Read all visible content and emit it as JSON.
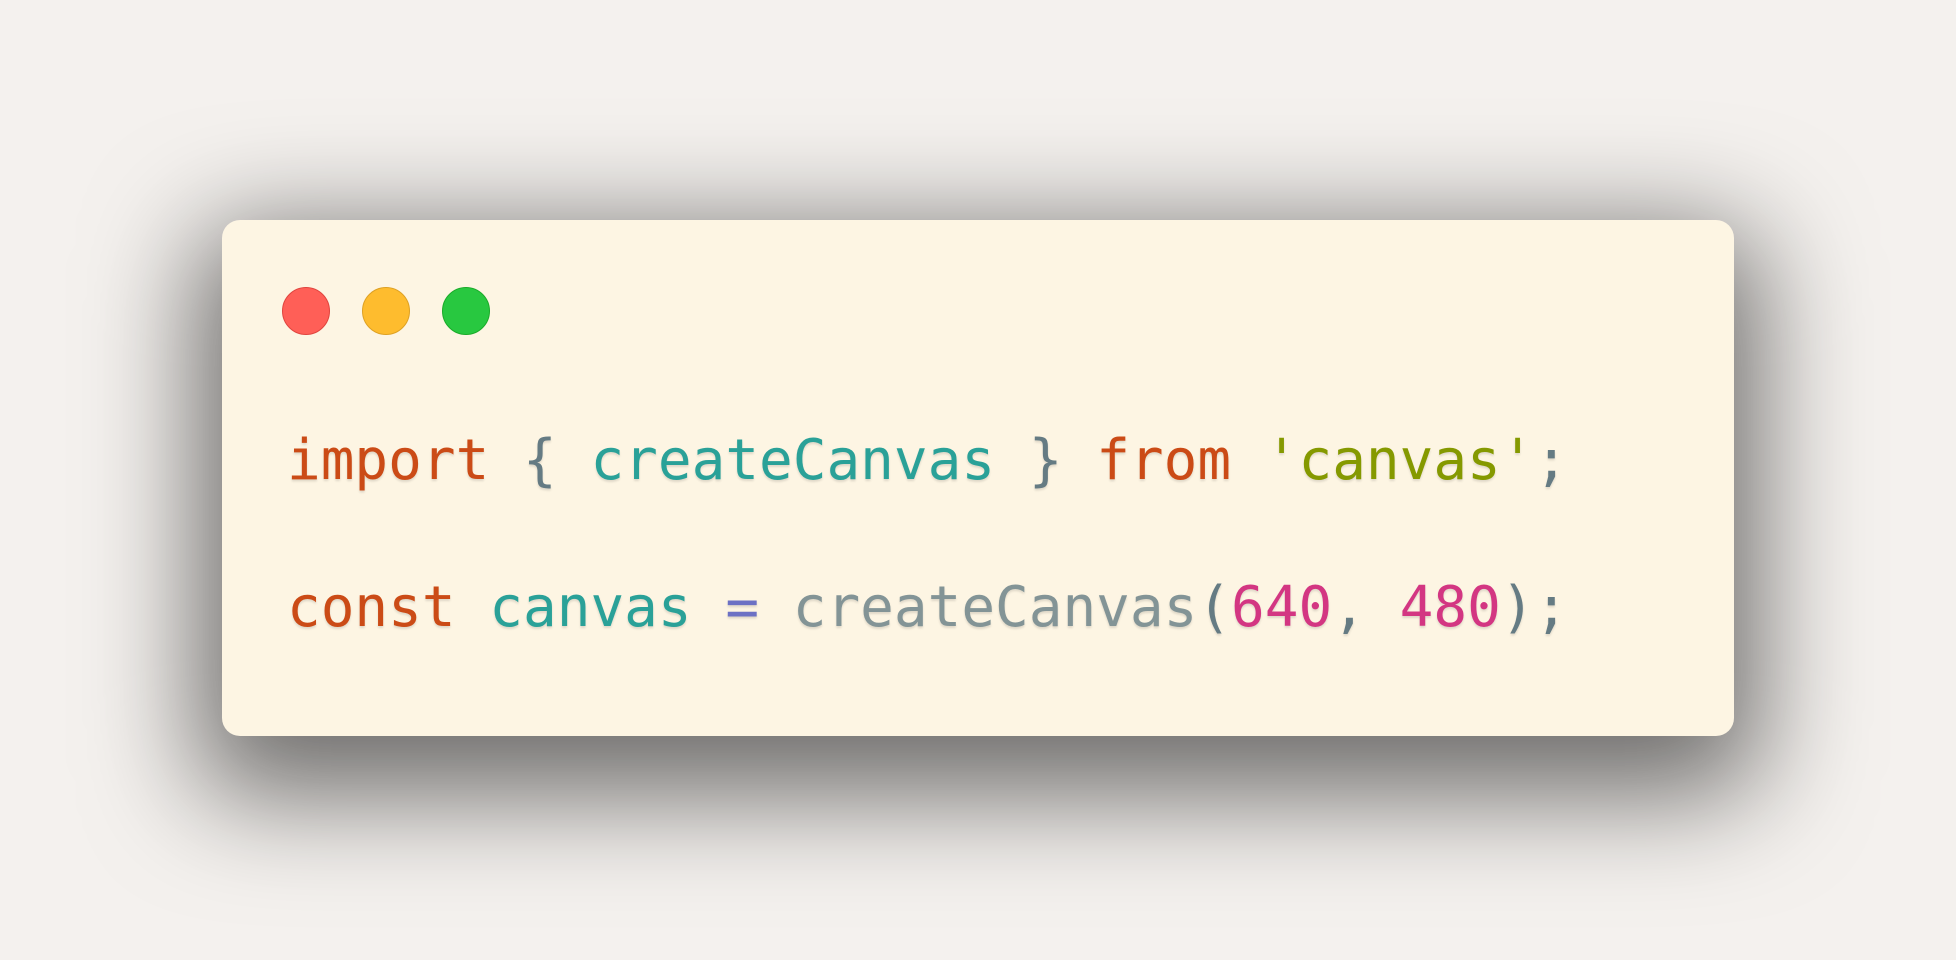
{
  "window_controls": {
    "close_color": "#ff5f57",
    "minimize_color": "#febc2e",
    "maximize_color": "#28c840"
  },
  "code": {
    "line1": {
      "kw_import": "import",
      "brace_open": " { ",
      "identifier": "createCanvas",
      "brace_close": " } ",
      "kw_from": "from",
      "space": " ",
      "module_string": "'canvas'",
      "semicolon": ";"
    },
    "line2": {
      "kw_const": "const",
      "space1": " ",
      "var_name": "canvas",
      "space2": " ",
      "operator": "=",
      "space3": " ",
      "fn_name": "createCanvas",
      "paren_open": "(",
      "arg1": "640",
      "comma": ", ",
      "arg2": "480",
      "paren_close": ");"
    }
  },
  "theme": {
    "background": "#fdf5e3",
    "keyword": "#cb4b16",
    "identifier": "#2aa198",
    "string": "#859900",
    "number": "#d33682",
    "operator": "#6c71c4",
    "punctuation": "#657b83"
  }
}
